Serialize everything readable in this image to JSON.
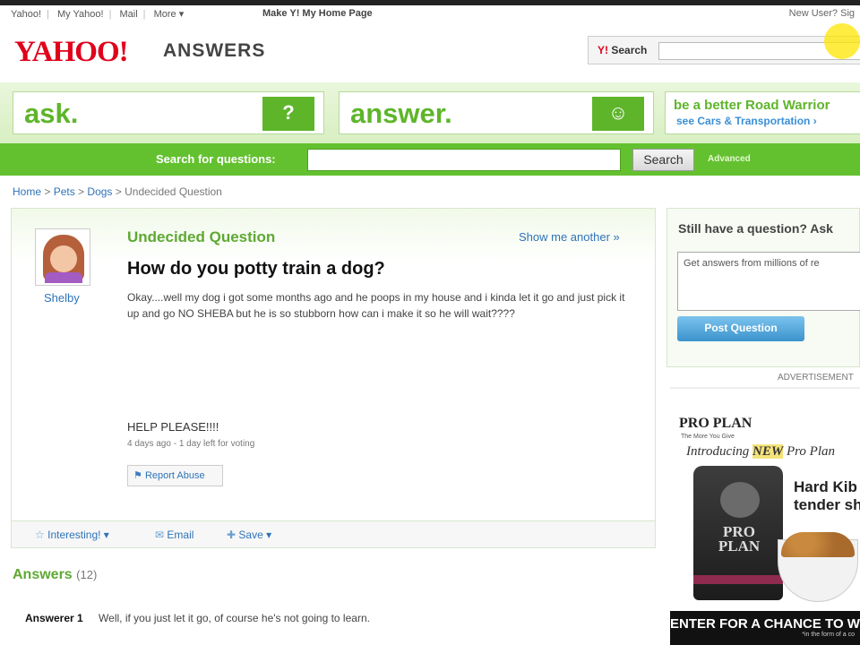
{
  "topbar": {
    "links": [
      "Yahoo!",
      "My Yahoo!",
      "Mail",
      "More ▾"
    ],
    "home": "Make Y! My Home Page",
    "right": "New User? Sig"
  },
  "header": {
    "logo": "YAHOO!",
    "logo_suffix": "ANSWERS",
    "search_label": "Search"
  },
  "band": {
    "ask": "ask.",
    "ask_glyph": "?",
    "answer": "answer.",
    "answer_glyph": "☺",
    "promo_line1": "be a better Road Warrior",
    "promo_line2": "see Cars & Transportation ›"
  },
  "qsearch": {
    "label": "Search for questions:",
    "button": "Search",
    "advanced": "Advanced"
  },
  "breadcrumb": {
    "home": "Home",
    "pets": "Pets",
    "dogs": "Dogs",
    "current": "Undecided Question"
  },
  "question": {
    "user": "Shelby",
    "status": "Undecided Question",
    "show_another": "Show me another »",
    "title": "How do you potty train a dog?",
    "body": "Okay....well my dog i got some months ago and he poops in my house and i kinda let it go and just pick it up and go NO SHEBA but he is so stubborn how can i make it so he will wait????",
    "help": "HELP PLEASE!!!!",
    "meta": "4 days ago - 1 day left for voting",
    "report": "Report Abuse"
  },
  "actions": {
    "interesting": "Interesting! ▾",
    "email": "Email",
    "save": "Save ▾"
  },
  "answers": {
    "heading": "Answers",
    "count": "(12)",
    "items": [
      {
        "author": "Answerer 1",
        "text": "Well, if you just let it go, of course he's not going to learn."
      }
    ]
  },
  "sidebar": {
    "heading": "Still have a question? Ask",
    "placeholder": "Get answers from millions of re",
    "button": "Post Question"
  },
  "ad": {
    "label": "ADVERTISEMENT",
    "brand": "PRO PLAN",
    "brand_sub": "The More You Give",
    "intro_pre": "Introducing ",
    "intro_new": "NEW",
    "intro_post": " Pro Plan",
    "bag_label": "PRO PLAN",
    "headline1": "Hard Kib",
    "headline2": "tender sh",
    "cta": "ENTER FOR A CHANCE TO W",
    "cta_small": "*in the form of a co"
  }
}
